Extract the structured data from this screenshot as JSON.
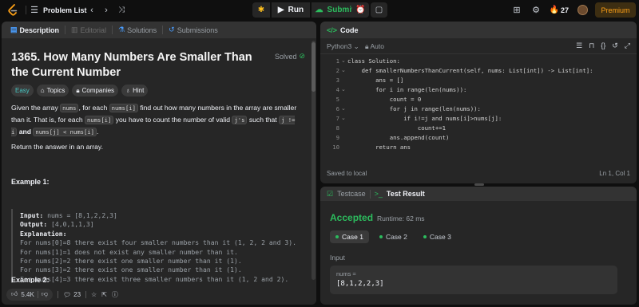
{
  "topbar": {
    "problem_list": "Problem List",
    "run": "Run",
    "submit": "Submit",
    "streak": "27",
    "premium": "Premium"
  },
  "left_tabs": [
    "Description",
    "Editorial",
    "Solutions",
    "Submissions"
  ],
  "problem": {
    "title": "1365. How Many Numbers Are Smaller Than the Current Number",
    "status": "Solved",
    "chips": [
      "Easy",
      "Topics",
      "Companies",
      "Hint"
    ],
    "desc_p1_a": "Given the array ",
    "desc_p1_nums": "nums",
    "desc_p1_b": ", for each ",
    "desc_p1_numsi": "nums[i]",
    "desc_p1_c": " find out how many numbers in the array are smaller than it. That is, for each ",
    "desc_p1_numsi2": "nums[i]",
    "desc_p1_d": " you have to count the number of valid ",
    "desc_p1_js": "j's",
    "desc_p1_e": " such that ",
    "desc_p1_cond1": "j != i",
    "desc_p1_and": "and",
    "desc_p1_cond2": "nums[j] < nums[i]",
    "desc_p1_end": ".",
    "desc_p2": "Return the answer in an array.",
    "example1_title": "Example 1:",
    "example1_input_label": "Input:",
    "example1_input": " nums = [8,1,2,2,3]",
    "example1_output_label": "Output:",
    "example1_output": " [4,0,1,1,3]",
    "example1_expl_label": "Explanation:",
    "example1_lines": [
      "For nums[0]=8 there exist four smaller numbers than it (1, 2, 2 and 3).",
      "For nums[1]=1 does not exist any smaller number than it.",
      "For nums[2]=2 there exist one smaller number than it (1).",
      "For nums[3]=2 there exist one smaller number than it (1).",
      "For nums[4]=3 there exist three smaller numbers than it (1, 2 and 2)."
    ],
    "example2_title": "Example 2:"
  },
  "bottom": {
    "likes": "5.4K",
    "comments": "23"
  },
  "code": {
    "tab": "Code",
    "language": "Python3",
    "mode": "Auto",
    "lines": [
      "class Solution:",
      "    def smallerNumbersThanCurrent(self, nums: List[int]) -> List[int]:",
      "        ans = []",
      "        for i in range(len(nums)):",
      "            count = 0",
      "            for j in range(len(nums)):",
      "                if i!=j and nums[i]>nums[j]:",
      "                    count+=1",
      "            ans.append(count)",
      "        return ans"
    ],
    "line_numbers": [
      "1",
      "2",
      "3",
      "4",
      "5",
      "6",
      "7",
      "8",
      "9",
      "10"
    ],
    "status": "Saved to local",
    "cursor": "Ln 1, Col 1"
  },
  "result": {
    "tab_testcase": "Testcase",
    "tab_result": "Test Result",
    "verdict": "Accepted",
    "runtime": "Runtime: 62 ms",
    "cases": [
      "Case 1",
      "Case 2",
      "Case 3"
    ],
    "input_label": "Input",
    "input_var": "nums =",
    "input_value": "[8,1,2,2,3]"
  },
  "colors": {
    "accepted": "#2cbb5d",
    "easy": "#46c6c2",
    "premium": "#ffa116",
    "panel": "#262626",
    "background": "#0f0f0f"
  }
}
